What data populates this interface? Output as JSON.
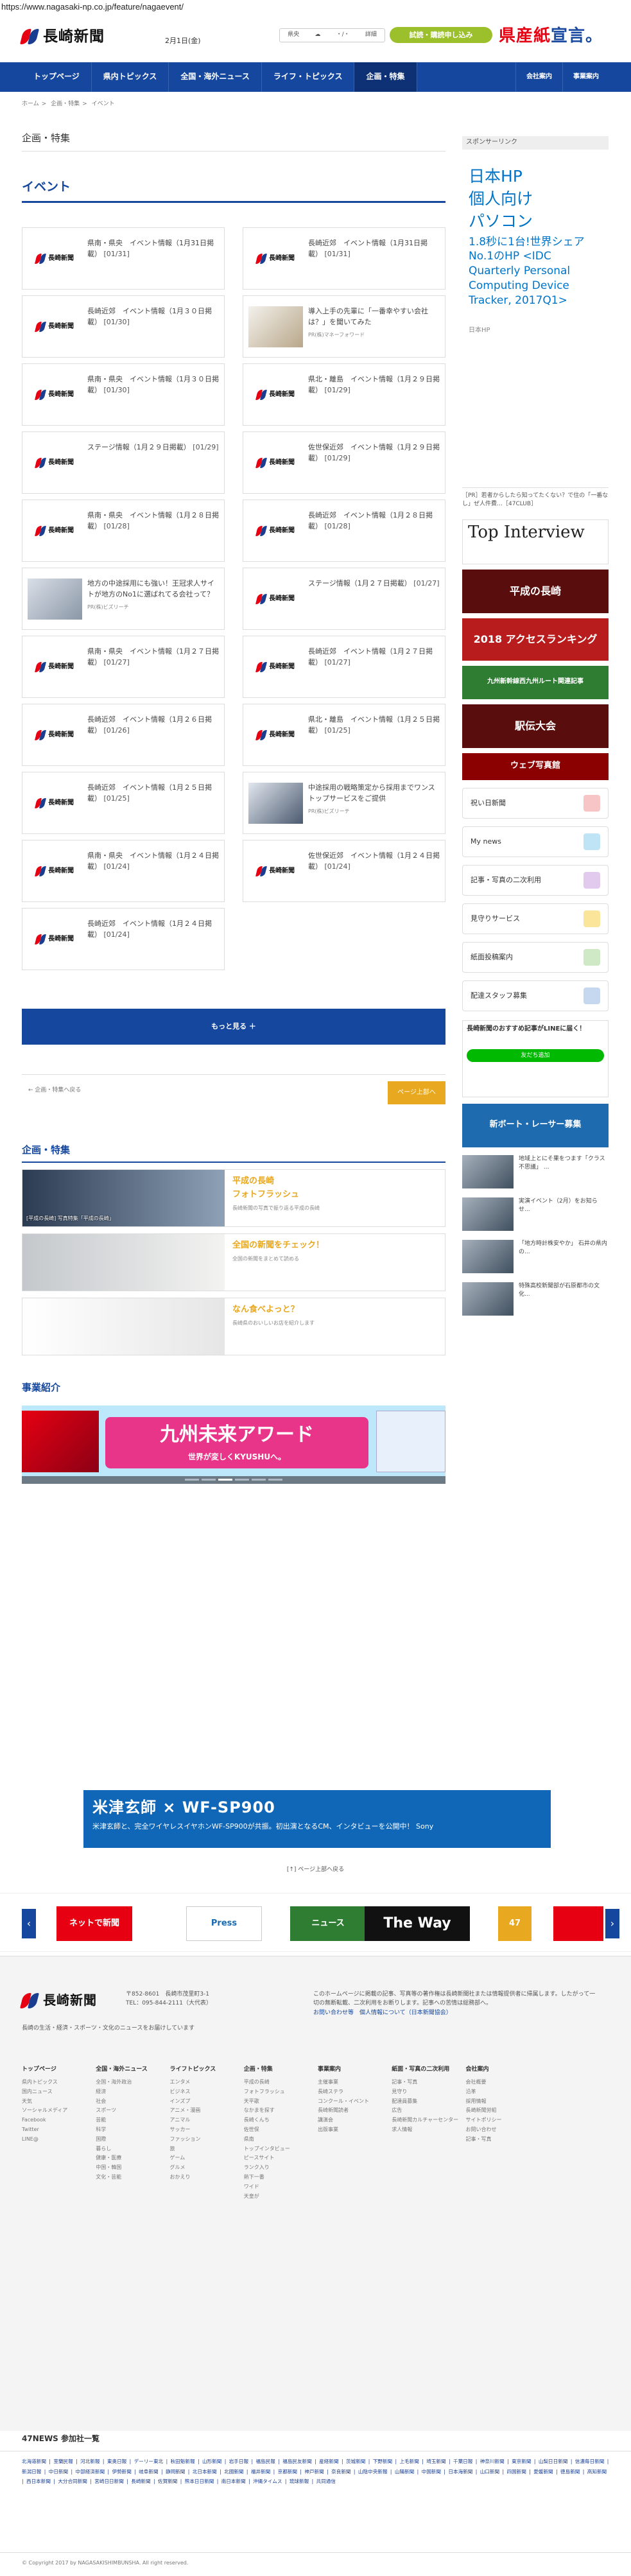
{
  "browser": {
    "url": "https://www.nagasaki-np.co.jp/feature/nagaevent/"
  },
  "header": {
    "logo_text": "長崎新聞",
    "date": "2月1日(金)",
    "weather_city": "県央",
    "weather_temp": "・/・",
    "weather_link": "詳細",
    "trial_button": "試読・購読申し込み",
    "kensan_a": "県産",
    "kensan_b": "紙",
    "kensan_c": "宣言。"
  },
  "nav": {
    "items": [
      "トップページ",
      "県内トピックス",
      "全国・海外ニュース",
      "ライフ・トピックス",
      "企画・特集"
    ],
    "active_index": 4,
    "right": [
      "会社案内",
      "事業案内"
    ]
  },
  "breadcrumb": [
    "ホーム",
    "企画・特集",
    "イベント"
  ],
  "page_title": "企画・特集",
  "section_title": "イベント",
  "cards": [
    {
      "title": "県南・県央　イベント情報（1月31日掲載）",
      "date": "[01/31]",
      "thumb": "logo",
      "pr": ""
    },
    {
      "title": "長崎近郊　イベント情報（1月31日掲載）",
      "date": "[01/31]",
      "thumb": "logo",
      "pr": ""
    },
    {
      "title": "長崎近郊　イベント情報（1月３０日掲載）",
      "date": "[01/30]",
      "thumb": "logo",
      "pr": ""
    },
    {
      "title": "導入上手の先輩に「一番幸やすい会社は？」を聞いてみた",
      "date": "",
      "thumb": "photo-b",
      "pr": "PR(株)マネーフォワード"
    },
    {
      "title": "県南・県央　イベント情報（1月３０日掲載）",
      "date": "[01/30]",
      "thumb": "logo",
      "pr": ""
    },
    {
      "title": "県北・離島　イベント情報（1月２９日掲載）",
      "date": "[01/29]",
      "thumb": "logo",
      "pr": ""
    },
    {
      "title": "ステージ情報（1月２９日掲載）",
      "date": "[01/29]",
      "thumb": "logo",
      "pr": ""
    },
    {
      "title": "佐世保近郊　イベント情報（1月２９日掲載）",
      "date": "[01/29]",
      "thumb": "logo",
      "pr": ""
    },
    {
      "title": "県南・県央　イベント情報（1月２８日掲載）",
      "date": "[01/28]",
      "thumb": "logo",
      "pr": ""
    },
    {
      "title": "長崎近郊　イベント情報（1月２８日掲載）",
      "date": "[01/28]",
      "thumb": "logo",
      "pr": ""
    },
    {
      "title": "地方の中途採用にも強い！王冠求人サイトが地方のNo1に選ばれてる会社って？",
      "date": "",
      "thumb": "photo-a",
      "pr": "PR(株)ビズリーチ"
    },
    {
      "title": "ステージ情報（1月２７日掲載）",
      "date": "[01/27]",
      "thumb": "logo",
      "pr": ""
    },
    {
      "title": "県南・県央　イベント情報（1月２７日掲載）",
      "date": "[01/27]",
      "thumb": "logo",
      "pr": ""
    },
    {
      "title": "長崎近郊　イベント情報（1月２７日掲載）",
      "date": "[01/27]",
      "thumb": "logo",
      "pr": ""
    },
    {
      "title": "長崎近郊　イベント情報（1月２６日掲載）",
      "date": "[01/26]",
      "thumb": "logo",
      "pr": ""
    },
    {
      "title": "県北・離島　イベント情報（1月２５日掲載）",
      "date": "[01/25]",
      "thumb": "logo",
      "pr": ""
    },
    {
      "title": "長崎近郊　イベント情報（1月２５日掲載）",
      "date": "[01/25]",
      "thumb": "logo",
      "pr": ""
    },
    {
      "title": "中途採用の戦略策定から採用までワンストップサービスをご提供",
      "date": "",
      "thumb": "photo-c",
      "pr": "PR(株)ビズリーチ"
    },
    {
      "title": "県南・県央　イベント情報（1月２４日掲載）",
      "date": "[01/24]",
      "thumb": "logo",
      "pr": ""
    },
    {
      "title": "佐世保近郊　イベント情報（1月２４日掲載）",
      "date": "[01/24]",
      "thumb": "logo",
      "pr": ""
    },
    {
      "title": "長崎近郊　イベント情報（1月２４日掲載）",
      "date": "[01/24]",
      "thumb": "logo",
      "pr": ""
    }
  ],
  "more_button": "もっと見る ＋",
  "pager": {
    "back": "← 企画・特集へ戻る",
    "top": "ページ上部へ"
  },
  "feature": {
    "title": "企画・特集",
    "rows": [
      {
        "caption": "[平成の長崎] 写真特集「平成の長崎」",
        "title_1": "平成の長崎",
        "title_2": "フォトフラッシュ",
        "desc": "長崎新聞の写真で振り返る平成の長崎"
      },
      {
        "caption": "",
        "title_1": "全国の新聞をチェック！",
        "title_2": "",
        "desc": "全国の新聞をまとめて読める"
      },
      {
        "caption": "",
        "title_1": "なん食べよっと？",
        "title_2": "",
        "desc": "長崎県のおいしいお店を紹介します"
      }
    ]
  },
  "biz": {
    "title": "事業紹介",
    "banner_main": "九州未来アワード",
    "banner_sub": "世界が変しくKYUSHUへ。"
  },
  "sidebar": {
    "sponsor_label": "スポンサーリンク",
    "ad_big_1": "日本HP",
    "ad_big_2": "個人向け",
    "ad_big_3": "パソコン",
    "ad_sm": "1.8秒に1台!世界シェアNo.1のHP <IDC Quarterly Personal Computing Device Tracker, 2017Q1>",
    "ad_hp": "日本HP",
    "pr_text": "［PR］若者からしたら知ってたくない？で住の「一番なし」ぜ人件費…［47CLUB］",
    "topint": "Top Interview",
    "bnr_heisei": "平成の長崎",
    "bnr_access": "2018 アクセスランキング",
    "bnr_kyushu": "九州新幹線西九州ルート関連記事",
    "bnr_ekiden": "駅伝大会",
    "bnr_web": "ウェブ写真館",
    "buttons": [
      "祝い日新聞",
      "My news",
      "記事・写真の二次利用",
      "見守りサービス",
      "紙面投稿案内",
      "配達スタッフ募集"
    ],
    "line_title": "長崎新聞のおすすめ記事がLINEに届く！",
    "line_btn": "友だち追加",
    "sbanner": "新ボート・レーサー募集",
    "news": [
      "地域上とにそ果をつます「クラス不思議」 ...",
      "実演イベント（2月）をお知らせ...",
      "「地方時計株安やか」 石井の県内の...",
      "特殊高校新聞部が石原都市の文化..."
    ]
  },
  "adlong": {
    "title": "米津玄師 × WF-SP900",
    "sub": "米津玄師と、完全ワイヤレスイヤホンWF-SP900が共振。初出演となるCM、インタビューを公開中！ Sony"
  },
  "page_top": "[↑] ページ上部へ戻る",
  "carousel": [
    "ネットで新聞",
    "Press",
    "ニュース",
    "The Way",
    "47"
  ],
  "footer": {
    "logo": "長崎新聞",
    "address_1": "〒852-8601　長崎市茂里町3-1",
    "address_2": "TEL：095-844-2111（大代表）",
    "tagline": "長崎の生活・経済・スポーツ・文化のニュースをお届けしています",
    "note": "このホームページに掲載の記事、写真等の著作権は長崎新聞社または情報提供者に帰属します。したがって一切の無断転載、二次利用をお断りします。記事への苦情は総務部へ。",
    "note_link_1": "お問い合わせ等",
    "note_link_2": "個人情報について（日本新聞協会）",
    "cols": [
      {
        "h": "トップページ",
        "items": [
          "県内トピックス",
          "国内ニュース",
          "天気",
          "ソーシャルメディア",
          "Facebook",
          "Twitter",
          "LINE@"
        ]
      },
      {
        "h": "全国・海外ニュース",
        "items": [
          "全国・海外政治",
          "経済",
          "社会",
          "スポーツ",
          "芸能",
          "科学",
          "国際",
          "暮らし",
          "健康・医療",
          "中国・韓国",
          "文化・芸能"
        ]
      },
      {
        "h": "ライフトピックス",
        "items": [
          "エンタメ",
          "ビジネス",
          "インズプ",
          "アニメ・漫画",
          "アニマル",
          "サッカー",
          "ファッション",
          "旅",
          "ゲーム",
          "グルメ",
          "おかえり"
        ]
      },
      {
        "h": "企画・特集",
        "items": [
          "平成の長崎",
          "フォトフラッシュ",
          "天平歌",
          "なかまを探す",
          "長崎くんち",
          "佐世保",
          "県南",
          "トップインタビュー",
          "ピースサイト",
          "ランク入り",
          "熱下一番",
          "ワイド",
          "天皇が"
        ]
      },
      {
        "h": "事業案内",
        "items": [
          "主催事業",
          "長崎ステラ",
          "コンクール・イベント",
          "長崎新聞読者",
          "講演会",
          "出版事業"
        ]
      },
      {
        "h": "紙面・写真の二次利用",
        "items": [
          "記事・写真",
          "見守り",
          "配達員募集",
          "広告",
          "長崎新聞カルチャーセンター",
          "求人情報"
        ]
      },
      {
        "h": "会社案内",
        "items": [
          "会社概要",
          "沿革",
          "採用情報",
          "長崎新聞労組",
          "サイトポリシー",
          "お問い合わせ",
          "記事・写真"
        ]
      },
      {
        "h": "",
        "items": []
      }
    ]
  },
  "n47": {
    "title": "47NEWS 参加社一覧",
    "links": "北海道新聞 | 室蘭民報 | 河北新報 | 東奥日報 | デーリー東北 | 秋田魁新報 | 山形新聞 | 岩手日報 | 福島民報 | 福島民友新聞 | 産経新聞 | 茨城新聞 | 下野新聞 | 上毛新聞 | 埼玉新聞 | 千葉日報 | 神奈川新聞 | 東京新聞 | 山梨日日新聞 | 信濃毎日新聞 | 新潟日報 | 中日新聞 | 中部経済新聞 | 伊勢新聞 | 岐阜新聞 | 静岡新聞 | 北日本新聞 | 北國新聞 | 福井新聞 | 京都新聞 | 神戸新聞 | 奈良新聞 | 山陰中央新報 | 山陽新聞 | 中国新聞 | 日本海新聞 | 山口新聞 | 四国新聞 | 愛媛新聞 | 徳島新聞 | 高知新聞 | 西日本新聞 | 大分合同新聞 | 宮崎日日新聞 | 長崎新聞 | 佐賀新聞 | 熊本日日新聞 | 南日本新聞 | 沖縄タイムス | 琉球新報 | 共同通信"
  },
  "copyright": "© Copyright 2017 by NAGASAKISHIMBUNSHA. All right reserved."
}
